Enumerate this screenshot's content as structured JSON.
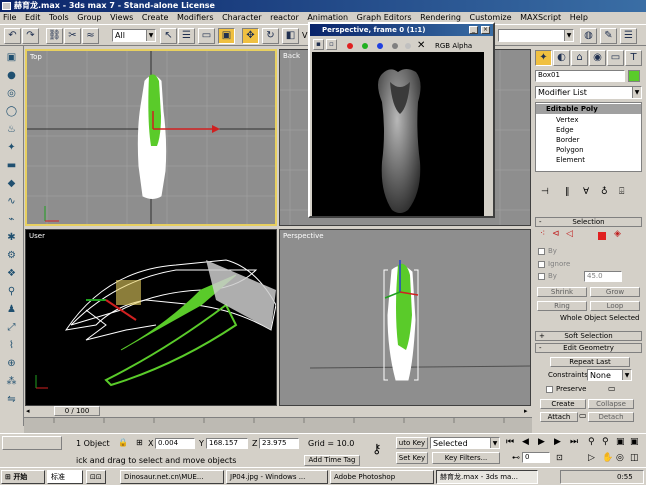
{
  "window": {
    "title": "赫育龙.max - 3ds max 7  - Stand-alone License"
  },
  "menu": [
    "File",
    "Edit",
    "Tools",
    "Group",
    "Views",
    "Create",
    "Modifiers",
    "Character",
    "reactor",
    "Animation",
    "Graph Editors",
    "Rendering",
    "Customize",
    "MAXScript",
    "Help"
  ],
  "toolbar": {
    "selection_filter": "All",
    "view_label": "V"
  },
  "viewports": {
    "top": "Top",
    "back": "Back",
    "user": "User",
    "perspective": "Perspective"
  },
  "render_window": {
    "title": "Perspective, frame 0 (1:1)",
    "channel": "RGB Alpha"
  },
  "command_panel": {
    "object_name": "Box01",
    "modifier_list": "Modifier List",
    "stack": {
      "base": "Editable Poly",
      "items": [
        "Vertex",
        "Edge",
        "Border",
        "Polygon",
        "Element"
      ]
    },
    "selection": {
      "title": "Selection",
      "by_vertex": "By",
      "ignore": "Ignore",
      "by_angle": "By",
      "angle_value": "45.0",
      "shrink": "Shrink",
      "grow": "Grow",
      "ring": "Ring",
      "loop": "Loop",
      "status": "Whole Object Selected"
    },
    "soft_selection": "Soft Selection",
    "edit_geometry": {
      "title": "Edit Geometry",
      "repeat_last": "Repeat Last",
      "constraints_label": "Constraints:",
      "constraints_value": "None",
      "preserve": "Preserve",
      "create": "Create",
      "collapse": "Collapse",
      "attach": "Attach",
      "detach": "Detach"
    }
  },
  "timeline": {
    "frame": "0 / 100"
  },
  "status": {
    "selected": "1 Object",
    "x_label": "X",
    "x": "0.004",
    "y_label": "Y",
    "y": "168.157",
    "z_label": "Z",
    "z": "23.975",
    "grid": "Grid = 10.0",
    "prompt": "ick and drag to select and move objects",
    "add_time_tag": "Add Time Tag",
    "auto_key": "uto Key",
    "selected_dd": "Selected",
    "set_key": "Set Key",
    "key_filters": "Key Filters...",
    "frame_field": "0"
  },
  "taskbar": {
    "start": "开始",
    "ime": "标准",
    "tasks": [
      "Dinosaur.net.cn\\MUE...",
      "JP04.jpg - Windows ...",
      "Adobe Photoshop",
      "赫育龙.max - 3ds ma..."
    ],
    "time": "0:55"
  },
  "colors": {
    "title_blue": "#0a246a",
    "viewport_black": "#000000",
    "mesh_green": "#5acb2a",
    "mesh_white": "#ffffff",
    "active_yellow": "#e8d060"
  }
}
